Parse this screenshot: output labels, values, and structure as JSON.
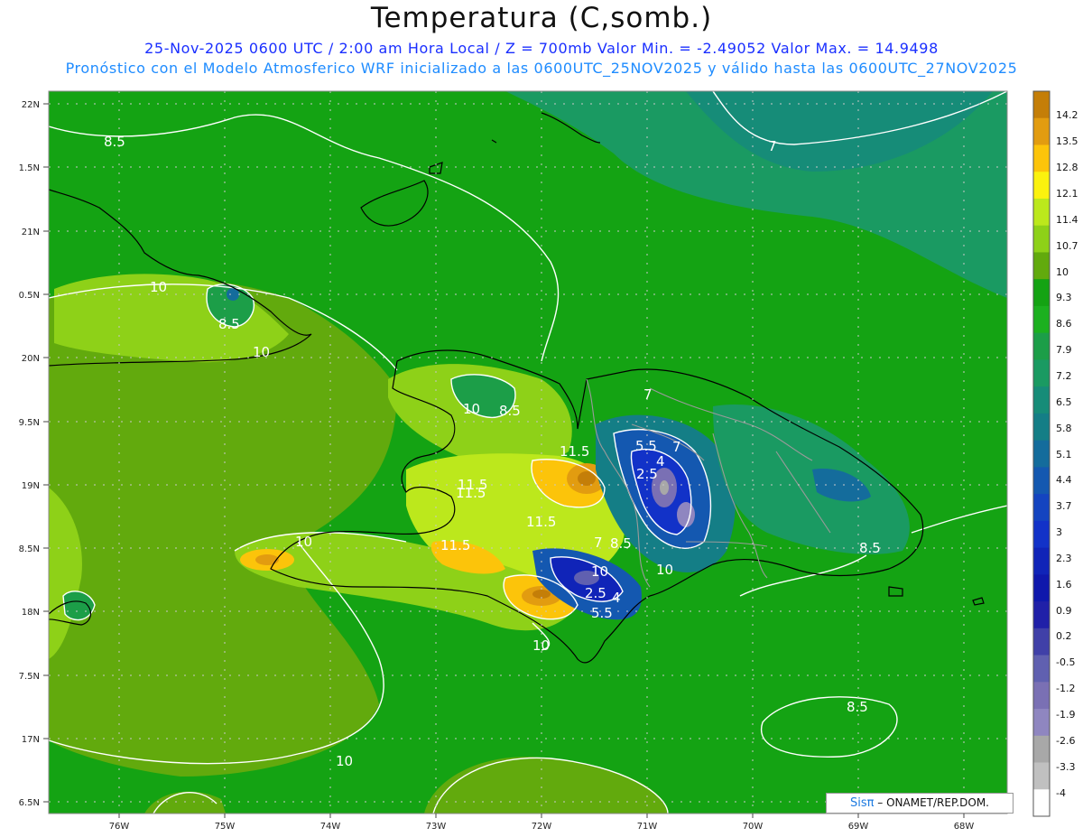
{
  "header": {
    "title": "Temperatura (C,somb.)",
    "subtitle_line1": "25-Nov-2025  0600 UTC / 2:00 am Hora Local / Z = 700mb   Valor Min. = -2.49052  Valor Max. = 14.9498",
    "subtitle_line2": "Pronóstico con el Modelo Atmosferico WRF inicializado a las 0600UTC_25NOV2025 y válido hasta las  0600UTC_27NOV2025"
  },
  "axes": {
    "lat_labels": [
      "22N",
      "1.5N",
      "21N",
      "0.5N",
      "20N",
      "9.5N",
      "19N",
      "8.5N",
      "18N",
      "7.5N",
      "17N",
      "6.5N"
    ],
    "lon_labels": [
      "76W",
      "75W",
      "74W",
      "73W",
      "72W",
      "71W",
      "70W",
      "69W",
      "68W"
    ]
  },
  "colorbar": {
    "labels": [
      "14.2",
      "13.5",
      "12.8",
      "12.1",
      "11.4",
      "10.7",
      "10",
      "9.3",
      "8.6",
      "7.9",
      "7.2",
      "6.5",
      "5.8",
      "5.1",
      "4.4",
      "3.7",
      "3",
      "2.3",
      "1.6",
      "0.9",
      "0.2",
      "-0.5",
      "-1.2",
      "-1.9",
      "-2.6",
      "-3.3",
      "-4"
    ],
    "colors": [
      "#c47e08",
      "#e29c10",
      "#fcc40a",
      "#fbf20e",
      "#bce81c",
      "#8ed118",
      "#62aa0d",
      "#14a313",
      "#1cb01f",
      "#1c9e48",
      "#1a9a62",
      "#168c78",
      "#147e86",
      "#146c9c",
      "#1458b0",
      "#1444c0",
      "#1232c8",
      "#1024b8",
      "#0f18ac",
      "#2020a8",
      "#4040a8",
      "#6060b0",
      "#7a70b4",
      "#8f86c0",
      "#a8a8a8",
      "#c0c0c0",
      "#ffffff"
    ]
  },
  "contour_labels": [
    "8.5",
    "7",
    "10",
    "8.5",
    "10",
    "10",
    "8.5",
    "11.5",
    "5.5",
    "7",
    "4",
    "2.5",
    "11.5",
    "11.5",
    "11.5",
    "7",
    "8.5",
    "10",
    "10",
    "2.5",
    "4",
    "5.5",
    "10",
    "7",
    "8.5",
    "8.5",
    "10",
    "11.5",
    "10"
  ],
  "footer": {
    "logo_prefix": "Sisπ",
    "logo_text": " – ONAMET/REP.DOM."
  }
}
